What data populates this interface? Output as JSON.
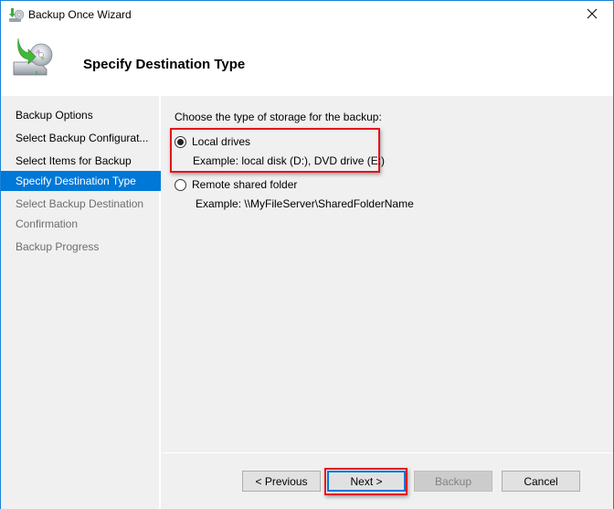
{
  "window": {
    "title": "Backup Once Wizard",
    "icon": "backup-wizard-icon",
    "close_icon": "close-icon",
    "accent_color": "#0078d7",
    "border_color": "#1883d7",
    "highlight_color": "#e3141b"
  },
  "header": {
    "title": "Specify Destination Type",
    "icon": "backup-drive-disc-icon"
  },
  "sidebar": {
    "items": [
      {
        "label": "Backup Options",
        "state": "done"
      },
      {
        "label": "Select Backup Configurat...",
        "state": "done"
      },
      {
        "label": "Select Items for Backup",
        "state": "done"
      },
      {
        "label": "Specify Destination Type",
        "state": "active"
      },
      {
        "label": "Select Backup Destination",
        "state": "pending"
      },
      {
        "label": "Confirmation",
        "state": "pending"
      },
      {
        "label": "Backup Progress",
        "state": "pending"
      }
    ]
  },
  "content": {
    "prompt": "Choose the type of storage for the backup:",
    "options": [
      {
        "label": "Local drives",
        "example": "Example: local disk (D:), DVD drive (E:)",
        "selected": true
      },
      {
        "label": "Remote shared folder",
        "example": "Example: \\\\MyFileServer\\SharedFolderName",
        "selected": false
      }
    ]
  },
  "buttons": {
    "previous": "< Previous",
    "next": "Next >",
    "backup": "Backup",
    "cancel": "Cancel"
  }
}
